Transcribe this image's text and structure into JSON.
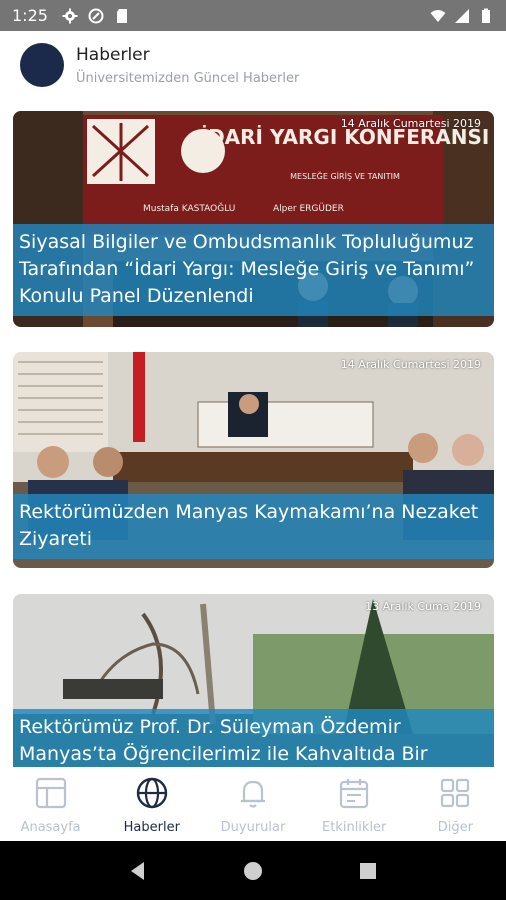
{
  "status_bar": {
    "time": "1:25"
  },
  "header": {
    "title": "Haberler",
    "subtitle": "Üniversitemizden Güncel Haberler"
  },
  "news": [
    {
      "date": "14 Aralık Cumartesi 2019",
      "title": "Siyasal Bilgiler ve Ombudsmanlık Topluluğumuz Tarafından “İdari Yargı: Mesleğe Giriş ve Tanımı” Konulu Panel Düzenlendi",
      "banner": "İDARİ YARGI KONFERANSI",
      "banner_sub": "MESLEĞE GİRİŞ VE TANITIM",
      "speaker_1": "Mustafa KASTAOĞLU",
      "speaker_2": "Alper ERGÜDER"
    },
    {
      "date": "14 Aralık Cumartesi 2019",
      "title": "Rektörümüzden Manyas Kaymakamı’na Nezaket Ziyareti"
    },
    {
      "date": "13 Aralık Cuma 2019",
      "title": "Rektörümüz Prof. Dr. Süleyman Özdemir Manyas’ta Öğrencilerimiz ile Kahvaltıda Bir"
    }
  ],
  "bottom_nav": [
    {
      "label": "Anasayfa",
      "icon": "layout-icon",
      "active": false
    },
    {
      "label": "Haberler",
      "icon": "globe-icon",
      "active": true
    },
    {
      "label": "Duyurular",
      "icon": "bell-icon",
      "active": false
    },
    {
      "label": "Etkinlikler",
      "icon": "calendar-icon",
      "active": false
    },
    {
      "label": "Diğer",
      "icon": "grid-icon",
      "active": false
    }
  ],
  "colors": {
    "status_bar": "#757575",
    "avatar": "#1b2a4a",
    "title_overlay": "#2187be",
    "nav_active": "#1e2b44",
    "nav_inactive": "#b8c2d0"
  }
}
